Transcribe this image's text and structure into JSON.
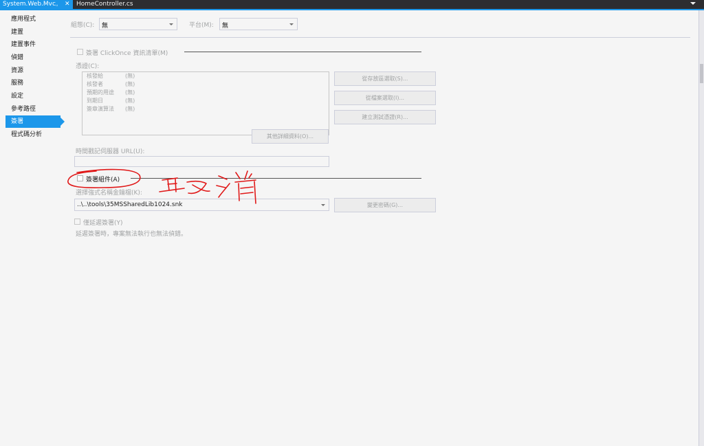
{
  "tabs": {
    "active": "System.Web.Mvc",
    "pin": "ᵤ",
    "close": "✕",
    "inactive": "HomeController.cs"
  },
  "sidebar": {
    "items": [
      {
        "label": "應用程式"
      },
      {
        "label": "建置"
      },
      {
        "label": "建置事件"
      },
      {
        "label": "偵錯"
      },
      {
        "label": "資源"
      },
      {
        "label": "服務"
      },
      {
        "label": "設定"
      },
      {
        "label": "參考路徑"
      },
      {
        "label": "簽署"
      },
      {
        "label": "程式碼分析"
      }
    ],
    "active_index": 8
  },
  "config": {
    "config_label": "組態(C):",
    "config_value": "無",
    "platform_label": "平台(M):",
    "platform_value": "無"
  },
  "clickonce": {
    "label": "簽署 ClickOnce 資訊清單(M)",
    "certificate_label": "憑證(C):",
    "fields": [
      {
        "key": "核發給",
        "value": "(無)"
      },
      {
        "key": "核發者",
        "value": "(無)"
      },
      {
        "key": "預期的用途",
        "value": "(無)"
      },
      {
        "key": "到期日",
        "value": "(無)"
      },
      {
        "key": "簽章演算法",
        "value": "(無)"
      }
    ],
    "buttons": {
      "from_store": "從存放區選取(S)...",
      "from_file": "從檔案選取(I)...",
      "create_test": "建立測試憑證(R)...",
      "more_details": "其他詳細資料(O)..."
    },
    "timestamp_label": "時間戳記伺服器 URL(U):",
    "timestamp_value": ""
  },
  "assembly": {
    "sign_label": "簽署組件(A)",
    "keyfile_label": "選擇強式名稱金鑰檔(K):",
    "keyfile_value": "..\\..\\tools\\35MSSharedLib1024.snk",
    "change_password": "變更密碼(G)...",
    "delay_sign_label": "僅延遲簽署(Y)",
    "delay_sign_note": "延遲簽署時，專案無法執行也無法偵錯。"
  },
  "colors": {
    "accent": "#1c97ea",
    "annotation": "#e01818"
  }
}
